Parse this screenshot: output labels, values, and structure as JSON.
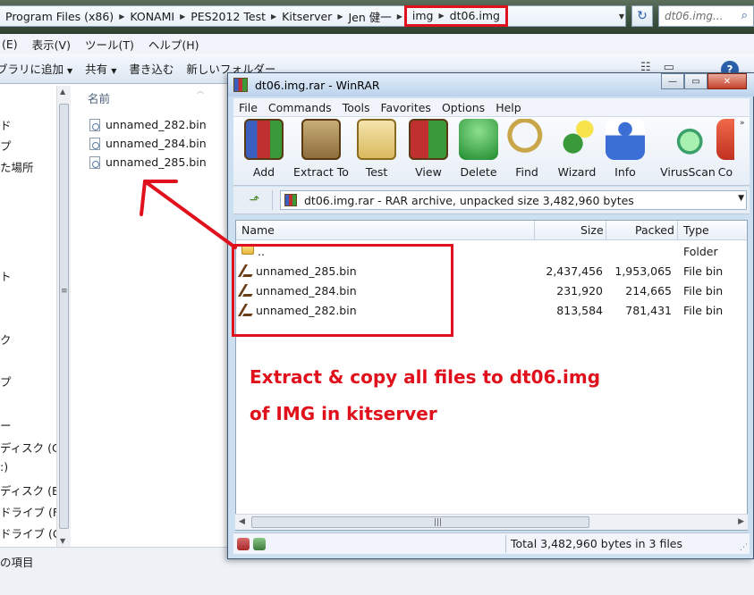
{
  "explorer": {
    "breadcrumbs": [
      "Program Files (x86)",
      "KONAMI",
      "PES2012 Test",
      "Kitserver",
      "Jen 健一"
    ],
    "highlighted_crumbs": [
      "img",
      "dt06.img"
    ],
    "search_placeholder": "dt06.img...",
    "menu": [
      "(E)",
      "表示(V)",
      "ツール(T)",
      "ヘルプ(H)"
    ],
    "toolbar": [
      "ブラリに追加",
      "共有",
      "書き込む",
      "新しいフォルダー"
    ],
    "nav_items": [
      "ド",
      "プ",
      "た場所",
      "ト",
      "ク",
      "プ",
      "ー",
      "ディスク (C:",
      ":)",
      "ディスク (E:)",
      "ドライブ (F:",
      "ドライブ (G:"
    ],
    "column_name": "名前",
    "files": [
      "unnamed_282.bin",
      "unnamed_284.bin",
      "unnamed_285.bin"
    ],
    "status": "の項目"
  },
  "winrar": {
    "title": "dt06.img.rar - WinRAR",
    "menu": [
      "File",
      "Commands",
      "Tools",
      "Favorites",
      "Options",
      "Help"
    ],
    "toolbar": [
      "Add",
      "Extract To",
      "Test",
      "View",
      "Delete",
      "Find",
      "Wizard",
      "Info",
      "VirusScan",
      "Co"
    ],
    "path": "dt06.img.rar - RAR archive, unpacked size 3,482,960 bytes",
    "columns": {
      "name": "Name",
      "size": "Size",
      "packed": "Packed",
      "type": "Type"
    },
    "rows": [
      {
        "name": "..",
        "size": "",
        "packed": "",
        "type": "Folder"
      },
      {
        "name": "unnamed_285.bin",
        "size": "2,437,456",
        "packed": "1,953,065",
        "type": "File bin"
      },
      {
        "name": "unnamed_284.bin",
        "size": "231,920",
        "packed": "214,665",
        "type": "File bin"
      },
      {
        "name": "unnamed_282.bin",
        "size": "813,584",
        "packed": "781,431",
        "type": "File bin"
      }
    ],
    "status_total": "Total 3,482,960 bytes in 3 files"
  },
  "annotation": {
    "line1": "Extract & copy all files to dt06.img",
    "line2": "of IMG in kitserver",
    "color": "#e0101c"
  }
}
